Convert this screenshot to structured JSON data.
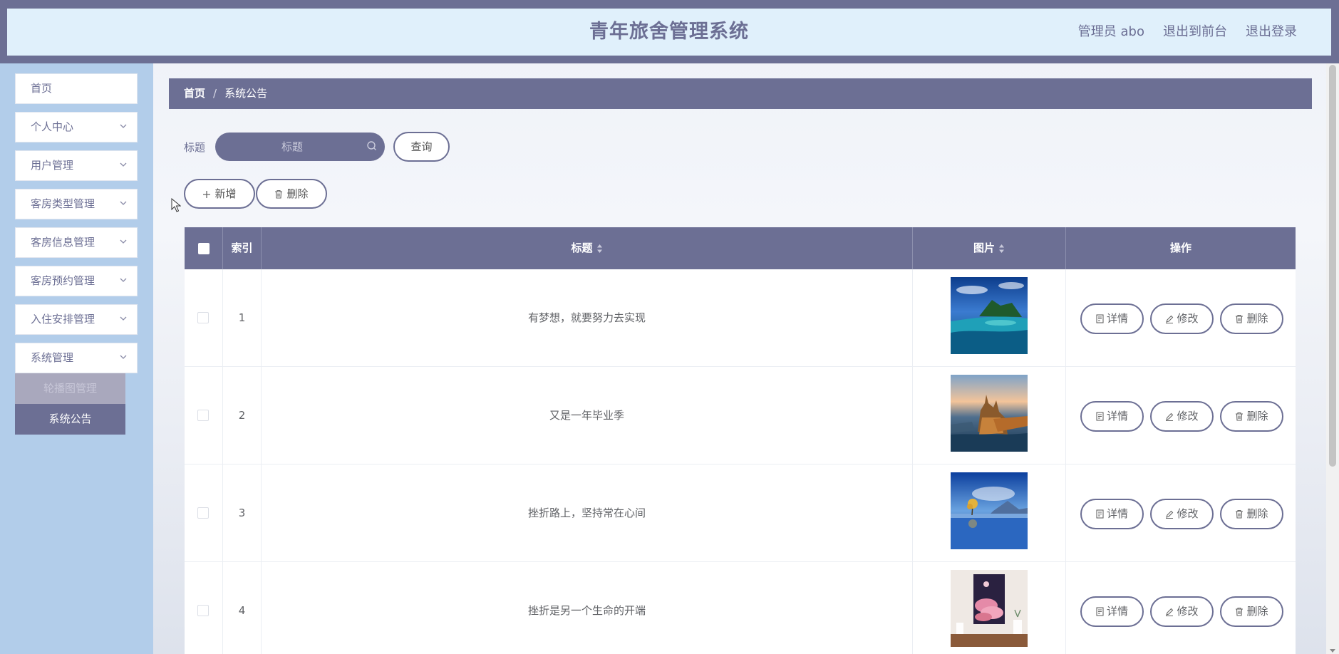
{
  "header": {
    "title": "青年旅舍管理系统",
    "admin": "管理员 abo",
    "front_link": "退出到前台",
    "logout": "退出登录"
  },
  "sidebar": {
    "items": [
      {
        "label": "首页",
        "has_submenu": false
      },
      {
        "label": "个人中心",
        "has_submenu": true
      },
      {
        "label": "用户管理",
        "has_submenu": true
      },
      {
        "label": "客房类型管理",
        "has_submenu": true
      },
      {
        "label": "客房信息管理",
        "has_submenu": true
      },
      {
        "label": "客房预约管理",
        "has_submenu": true
      },
      {
        "label": "入住安排管理",
        "has_submenu": true
      },
      {
        "label": "系统管理",
        "has_submenu": true
      }
    ],
    "sub_items": [
      {
        "label": "轮播图管理",
        "state": "faded"
      },
      {
        "label": "系统公告",
        "state": "active"
      }
    ]
  },
  "breadcrumb": {
    "home": "首页",
    "separator": "/",
    "current": "系统公告"
  },
  "search": {
    "label": "标题",
    "placeholder": "标题",
    "value": "",
    "query_button": "查询"
  },
  "actions": {
    "add": "新增",
    "delete": "删除"
  },
  "table": {
    "columns": {
      "index": "索引",
      "title": "标题",
      "image": "图片",
      "actions": "操作"
    },
    "row_actions": {
      "detail": "详情",
      "edit": "修改",
      "delete": "删除"
    },
    "rows": [
      {
        "index": "1",
        "title": "有梦想，就要努力去实现",
        "image": "island-lagoon"
      },
      {
        "index": "2",
        "title": "又是一年毕业季",
        "image": "castle-lake-sunset"
      },
      {
        "index": "3",
        "title": "挫折路上，坚持常在心间",
        "image": "lone-tree-lake"
      },
      {
        "index": "4",
        "title": "挫折是另一个生命的开端",
        "image": "pink-clouds-poster"
      }
    ]
  },
  "colors": {
    "primary": "#6c6f94",
    "header_bg": "#e0f0fb",
    "sidebar_bg": "#b2cdea",
    "white": "#ffffff"
  }
}
